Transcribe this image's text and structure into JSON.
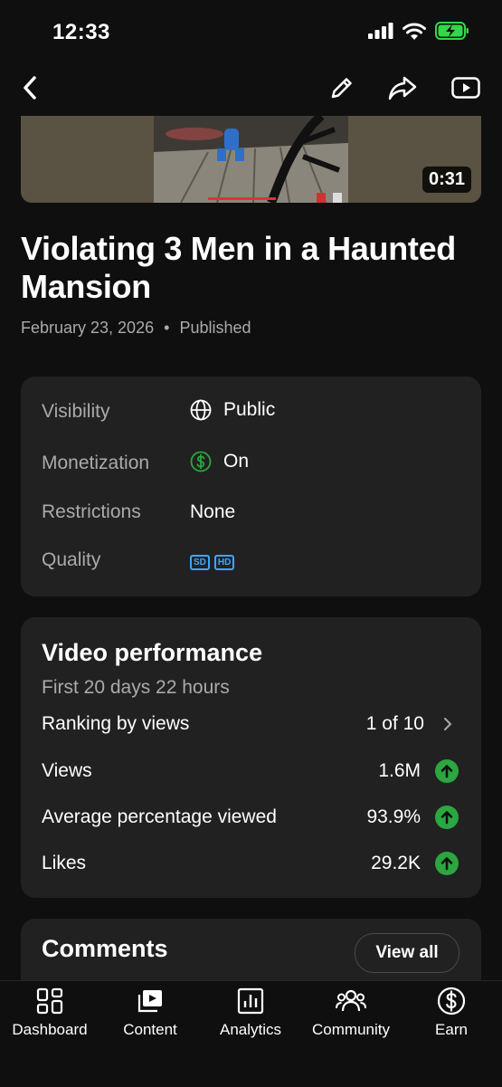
{
  "status": {
    "time": "12:33"
  },
  "video": {
    "duration": "0:31",
    "title": "Violating 3 Men in a Haunted Mansion",
    "date": "February 23, 2026",
    "separator": "•",
    "status": "Published"
  },
  "details": {
    "rows": [
      {
        "label": "Visibility",
        "value": "Public",
        "icon": "globe-icon"
      },
      {
        "label": "Monetization",
        "value": "On",
        "icon": "dollar-circle-icon"
      },
      {
        "label": "Restrictions",
        "value": "None"
      },
      {
        "label": "Quality",
        "badges": [
          "SD",
          "HD"
        ]
      }
    ]
  },
  "performance": {
    "title": "Video performance",
    "subtitle": "First 20 days 22 hours",
    "ranking": {
      "label": "Ranking by views",
      "value": "1 of 10"
    },
    "metrics": [
      {
        "label": "Views",
        "value": "1.6M"
      },
      {
        "label": "Average percentage viewed",
        "value": "93.9%"
      },
      {
        "label": "Likes",
        "value": "29.2K"
      }
    ]
  },
  "comments": {
    "title": "Comments",
    "view_all": "View all"
  },
  "nav": {
    "items": [
      {
        "label": "Dashboard",
        "icon": "dashboard-icon"
      },
      {
        "label": "Content",
        "icon": "content-icon"
      },
      {
        "label": "Analytics",
        "icon": "analytics-icon"
      },
      {
        "label": "Community",
        "icon": "community-icon"
      },
      {
        "label": "Earn",
        "icon": "earn-icon"
      }
    ]
  },
  "colors": {
    "background": "#0f0f0f",
    "card": "#212121",
    "success": "#2ba640",
    "accent": "#3ea6ff",
    "battery": "#32d74b"
  }
}
